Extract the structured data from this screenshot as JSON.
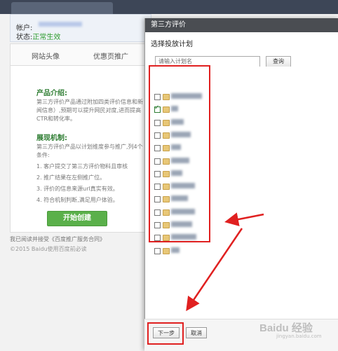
{
  "account": {
    "label": "帐户:",
    "status_label": "状态:",
    "status_value": "正常生效"
  },
  "panel": {
    "tabs": [
      "网站头像",
      "优惠页推广"
    ],
    "intro_title": "产品介绍:",
    "intro_text": "第三方评价产品通过附加四类评价信息和新闻信息）,预期可以提升网民对度,进而提高CTR和转化率。",
    "mechanism_title": "展现机制:",
    "mechanism_text": "第三方评价产品以计划维度参与推广,列4个条件:",
    "conditions": [
      "1.  客户提交了第三方评价物料且审核",
      "2.  推广结果在左侧推广位。",
      "3.  评价的信息来源url真实有效。",
      "4.  符合机制判断,满足用户体验。"
    ],
    "start_button": "开始创建"
  },
  "footer": {
    "agreement": "我已阅读并接受《百度推广服务合同》",
    "copyright": "©2015 Baidu使用百度前必读"
  },
  "dialog": {
    "title": "第三方评价",
    "subtitle": "选择投放计划",
    "search_placeholder": "请输入计划名",
    "query_button": "查询",
    "plans": [
      {
        "checked": false
      },
      {
        "checked": true
      },
      {
        "checked": false
      },
      {
        "checked": false
      },
      {
        "checked": false
      },
      {
        "checked": false
      },
      {
        "checked": false
      },
      {
        "checked": false
      },
      {
        "checked": false
      },
      {
        "checked": false
      },
      {
        "checked": false
      },
      {
        "checked": false
      },
      {
        "checked": false
      }
    ],
    "next_button": "下一步",
    "cancel_button": "取消"
  },
  "watermark": {
    "text": "Baidu 经验",
    "sub": "jingyan.baidu.com"
  },
  "colors": {
    "highlight": "#e02020",
    "status": "#2e9c2e",
    "section": "#2e7d32"
  }
}
